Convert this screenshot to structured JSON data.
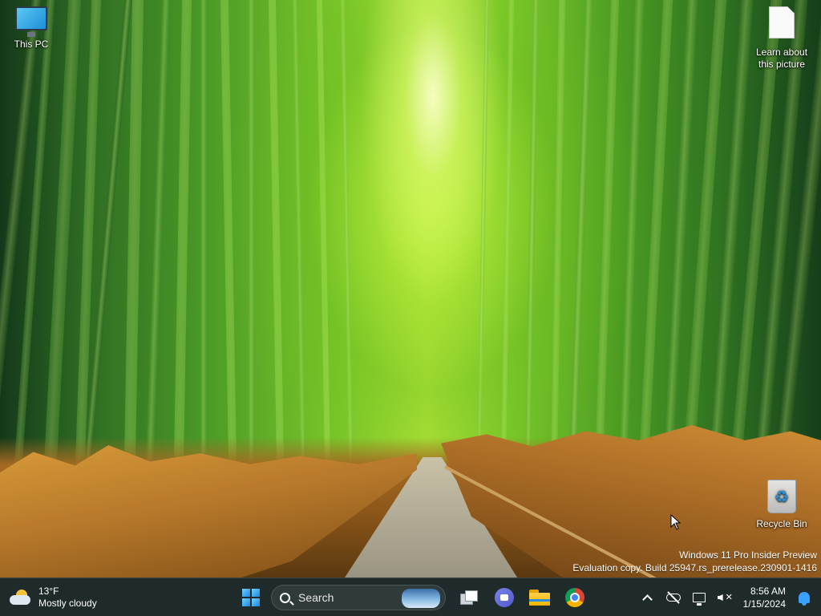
{
  "desktop": {
    "icons": [
      {
        "label": "This PC",
        "icon": "monitor-icon"
      },
      {
        "label": "Learn about\nthis picture",
        "icon": "document-icon"
      },
      {
        "label": "Recycle Bin",
        "icon": "recycle-bin-icon"
      }
    ],
    "watermark": {
      "line1": "Windows 11 Pro Insider Preview",
      "line2": "Evaluation copy. Build 25947.rs_prerelease.230901-1416"
    }
  },
  "taskbar": {
    "weather": {
      "temperature": "13°F",
      "condition": "Mostly cloudy",
      "icon": "partly-cloudy-icon"
    },
    "search": {
      "label": "Search"
    },
    "pinned": [
      {
        "name": "start",
        "icon": "windows-start-icon"
      },
      {
        "name": "task-view",
        "icon": "task-view-icon"
      },
      {
        "name": "meet-now",
        "icon": "meet-now-icon"
      },
      {
        "name": "file-explorer",
        "icon": "folder-icon"
      },
      {
        "name": "chrome",
        "icon": "chrome-icon"
      }
    ],
    "tray": {
      "time": "8:56 AM",
      "date": "1/15/2024"
    }
  },
  "colors": {
    "taskbar_bg": "#1f2a2a",
    "accent": "#3aa0ff"
  }
}
